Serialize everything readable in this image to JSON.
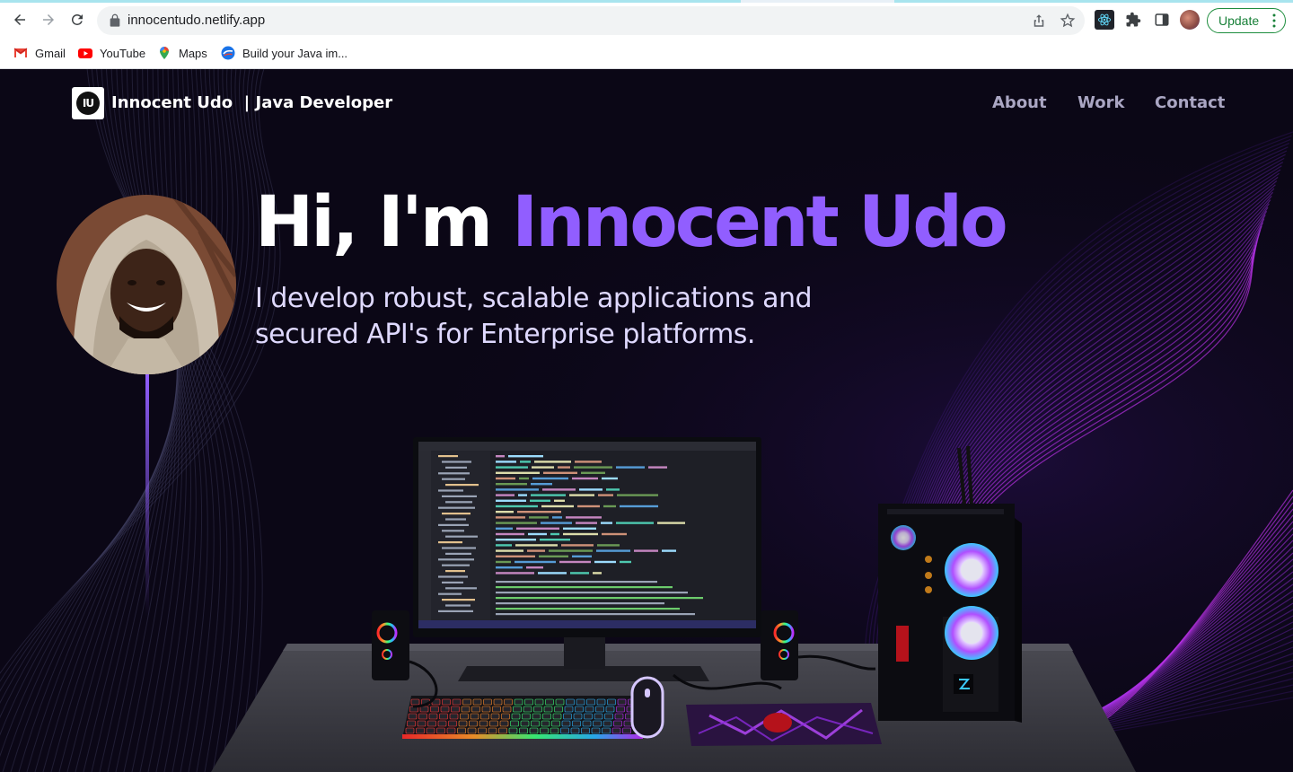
{
  "browser": {
    "url": "innocentudo.netlify.app",
    "update_label": "Update",
    "bookmarks": [
      {
        "label": "Gmail",
        "icon": "gmail-icon"
      },
      {
        "label": "YouTube",
        "icon": "youtube-icon"
      },
      {
        "label": "Maps",
        "icon": "maps-icon"
      },
      {
        "label": "Build your Java im...",
        "icon": "build-icon"
      }
    ]
  },
  "nav": {
    "logo_text": "IU",
    "title": "Innocent Udo  | Java Developer",
    "links": [
      "About",
      "Work",
      "Contact"
    ]
  },
  "hero": {
    "greeting": "Hi, I'm ",
    "name": "Innocent Udo",
    "subtitle": "I develop robust, scalable applications and secured API's for Enterprise platforms."
  },
  "colors": {
    "accent": "#915eff",
    "page_bg": "#0b0716",
    "nav_link": "#aaa6c3",
    "update_green": "#188038"
  }
}
